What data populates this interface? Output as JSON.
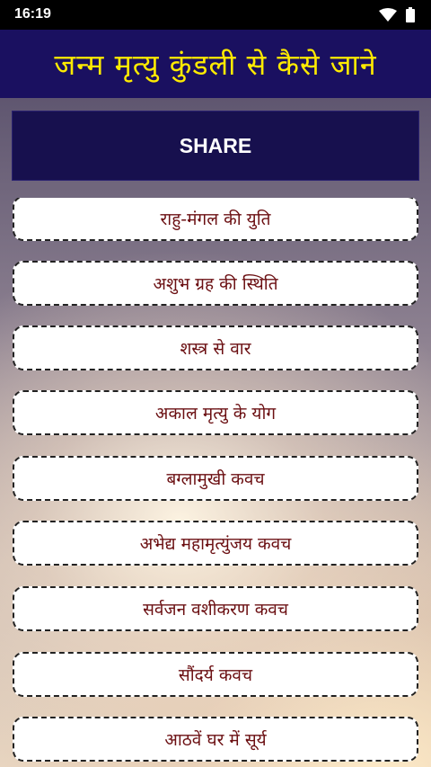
{
  "status_bar": {
    "time": "16:19",
    "icons": [
      "wifi-icon",
      "battery-icon"
    ]
  },
  "header": {
    "title": "जन्म मृत्यु कुंडली से कैसे जाने"
  },
  "share_button": {
    "label": "SHARE"
  },
  "list": {
    "items": [
      "राहु-मंगल की युति",
      "अशुभ ग्रह की स्थिति",
      "शस्त्र से वार",
      "अकाल मृत्यु के योग",
      "बग्लामुखी कवच",
      "अभेद्य महामृत्युंजय कवच",
      "सर्वजन वशीकरण कवच",
      "सौंदर्य कवच",
      "आठवें घर में सूर्य"
    ]
  },
  "colors": {
    "header_bg": "#1a1060",
    "header_text": "#ffeb00",
    "share_bg": "#17104e",
    "item_text": "#6b0f12"
  }
}
